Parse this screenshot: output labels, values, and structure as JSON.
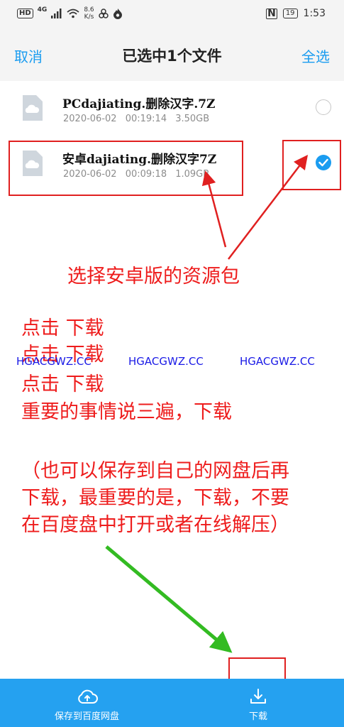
{
  "status_bar": {
    "hd": "HD",
    "signal": "4G",
    "net_speed_value": "8.6",
    "net_speed_unit": "K/s",
    "battery": "19",
    "time": "1:53"
  },
  "header": {
    "cancel_label": "取消",
    "title": "已选中1个文件",
    "select_all_label": "全选"
  },
  "files": [
    {
      "name": "PCdajiating.删除汉字.7Z",
      "date": "2020-06-02",
      "time": "00:19:14",
      "size": "3.50GB",
      "selected": false
    },
    {
      "name": "安卓dajiating.删除汉字7Z",
      "date": "2020-06-02",
      "time": "00:09:18",
      "size": "1.09GB",
      "selected": true
    }
  ],
  "annotations": {
    "choose": "选择安卓版的资源包",
    "click1": "点击  下载",
    "click2": "点击  下载",
    "click3": "点击  下载",
    "important": "重要的事情说三遍，下载",
    "note1": "（也可以保存到自己的网盘后再",
    "note2": "下载，最重要的是，下载，不要",
    "note3": "在百度盘中打开或者在线解压）"
  },
  "watermarks": [
    "HGACGWZ.CC",
    "HGACGWZ.CC",
    "HGACGWZ.CC"
  ],
  "bottom_bar": {
    "save_label": "保存到百度网盘",
    "download_label": "下载"
  },
  "colors": {
    "accent": "#1a9cf0",
    "annotation_red": "#ee1c1c",
    "arrow_green": "#33bb22",
    "bottom_bar": "#25a1f0"
  }
}
